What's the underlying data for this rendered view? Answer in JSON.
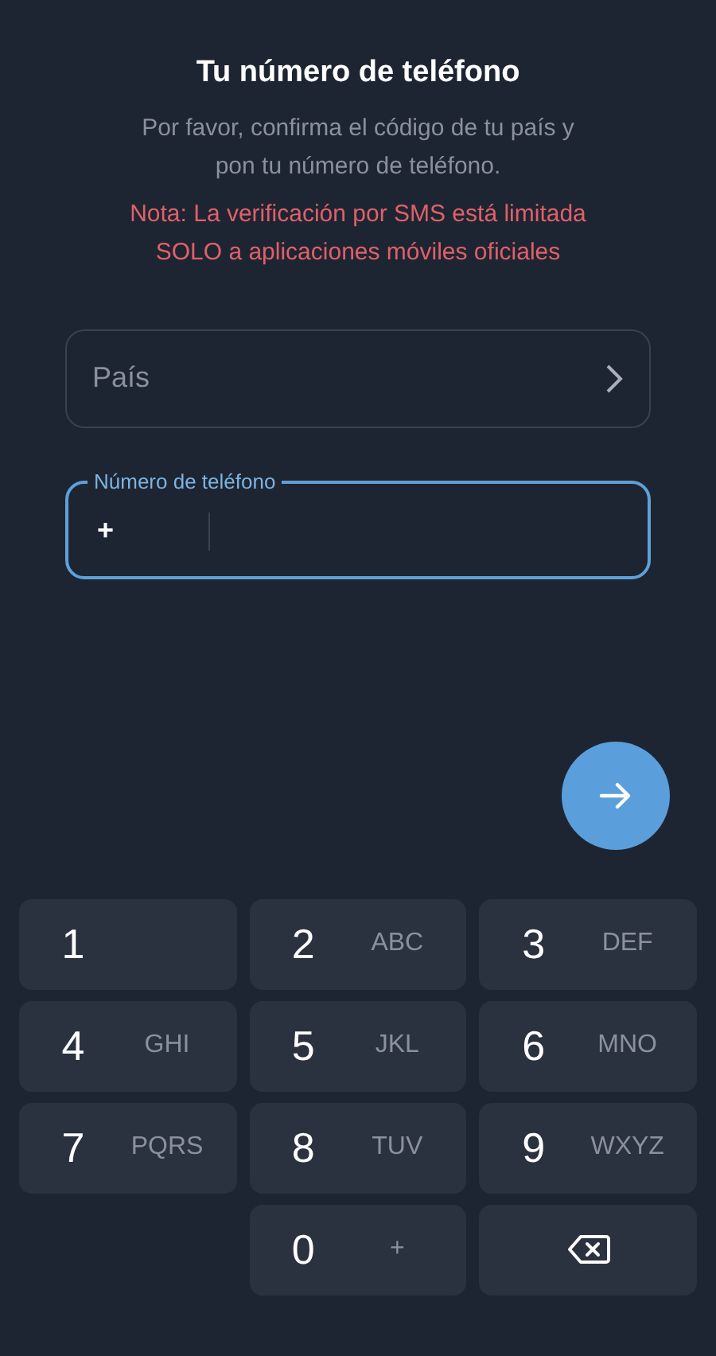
{
  "title": "Tu número de teléfono",
  "subtitle": "Por favor, confirma el código de tu país y pon tu número de teléfono.",
  "note": "Nota: La verificación por SMS está limitada SOLO a aplicaciones móviles oficiales",
  "country_field": {
    "placeholder": "País"
  },
  "phone_field": {
    "label": "Número de teléfono",
    "prefix": "+",
    "focused": true
  },
  "keypad": [
    {
      "kind": "digit",
      "digit": "1"
    },
    {
      "kind": "digit",
      "digit": "2",
      "letters": "ABC"
    },
    {
      "kind": "digit",
      "digit": "3",
      "letters": "DEF"
    },
    {
      "kind": "digit",
      "digit": "4",
      "letters": "GHI"
    },
    {
      "kind": "digit",
      "digit": "5",
      "letters": "JKL"
    },
    {
      "kind": "digit",
      "digit": "6",
      "letters": "MNO"
    },
    {
      "kind": "digit",
      "digit": "7",
      "letters": "PQRS"
    },
    {
      "kind": "digit",
      "digit": "8",
      "letters": "TUV"
    },
    {
      "kind": "digit",
      "digit": "9",
      "letters": "WXYZ"
    },
    {
      "kind": "empty"
    },
    {
      "kind": "digit",
      "digit": "0",
      "letters": "+"
    },
    {
      "kind": "backspace"
    }
  ]
}
